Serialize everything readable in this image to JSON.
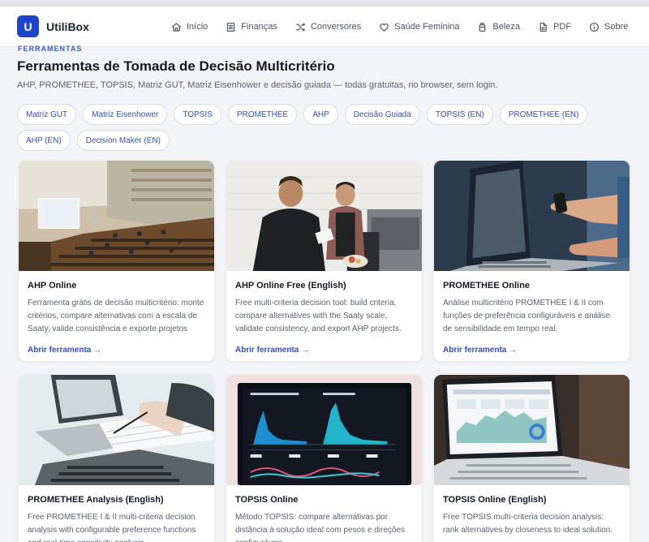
{
  "brand": {
    "logo_letter": "U",
    "name": "UtiliBox"
  },
  "nav": [
    {
      "label": "Início",
      "icon": "home-icon"
    },
    {
      "label": "Finanças",
      "icon": "document-icon"
    },
    {
      "label": "Conversores",
      "icon": "shuffle-icon"
    },
    {
      "label": "Saúde Feminina",
      "icon": "heart-icon"
    },
    {
      "label": "Beleza",
      "icon": "bottle-icon"
    },
    {
      "label": "PDF",
      "icon": "file-icon"
    },
    {
      "label": "Sobre",
      "icon": "info-icon"
    }
  ],
  "page": {
    "eyebrow": "FERRAMENTAS",
    "title": "Ferramentas de Tomada de Decisão Multicritério",
    "subtitle": "AHP, PROMETHEE, TOPSIS, Matriz GUT, Matriz Eisenhower e decisão guiada — todas gratuitas, no browser, sem login."
  },
  "chips": [
    "Matriz GUT",
    "Matriz Eisenhower",
    "TOPSIS",
    "PROMETHEE",
    "AHP",
    "Decisão Guiada",
    "TOPSIS (EN)",
    "PROMETHEE (EN)",
    "AHP (EN)",
    "Decision Maker (EN)"
  ],
  "cards": [
    {
      "title": "AHP Online",
      "desc": "Ferramenta grátis de decisão multicritério: monte critérios, compare alternativas com a escala de Saaty, valide consistência e exporte projetos AHP.",
      "link": "Abrir ferramenta →"
    },
    {
      "title": "AHP Online Free (English)",
      "desc": "Free multi-criteria decision tool: build criteria, compare alternatives with the Saaty scale, validate consistency, and export AHP projects.",
      "link": "Abrir ferramenta →"
    },
    {
      "title": "PROMETHEE Online",
      "desc": "Análise multicritério PROMETHEE I & II com funções de preferência configuráveis e análise de sensibilidade em tempo real.",
      "link": "Abrir ferramenta →"
    },
    {
      "title": "PROMETHEE Analysis (English)",
      "desc": "Free PROMETHEE I & II multi-criteria decision analysis with configurable preference functions and real-time sensitivity analysis.",
      "link": ""
    },
    {
      "title": "TOPSIS Online",
      "desc": "Método TOPSIS: compare alternativas por distância à solução ideal com pesos e direções configuráveis.",
      "link": ""
    },
    {
      "title": "TOPSIS Online (English)",
      "desc": "Free TOPSIS multi-criteria decision analysis: rank alternatives by closeness to ideal solution.",
      "link": ""
    }
  ]
}
